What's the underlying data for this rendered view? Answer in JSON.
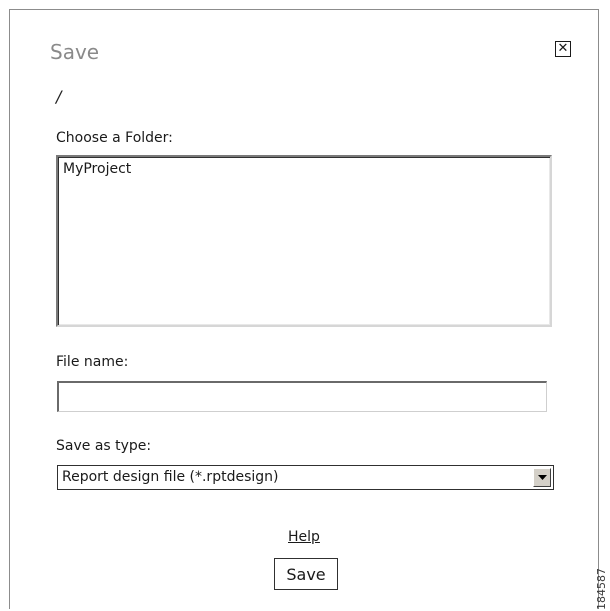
{
  "dialog": {
    "title": "Save",
    "close_glyph": "✕",
    "close_icon": "close-icon",
    "path": "/"
  },
  "folder": {
    "label": "Choose a Folder:",
    "items": [
      "MyProject"
    ]
  },
  "file_name": {
    "label": "File name:",
    "value": "",
    "placeholder": ""
  },
  "save_type": {
    "label": "Save as type:",
    "selected": "Report design file (*.rptdesign)",
    "arrow_icon": "dropdown-arrow-icon"
  },
  "footer": {
    "help_label": "Help",
    "save_label": "Save"
  },
  "watermark": {
    "text": "184587"
  }
}
